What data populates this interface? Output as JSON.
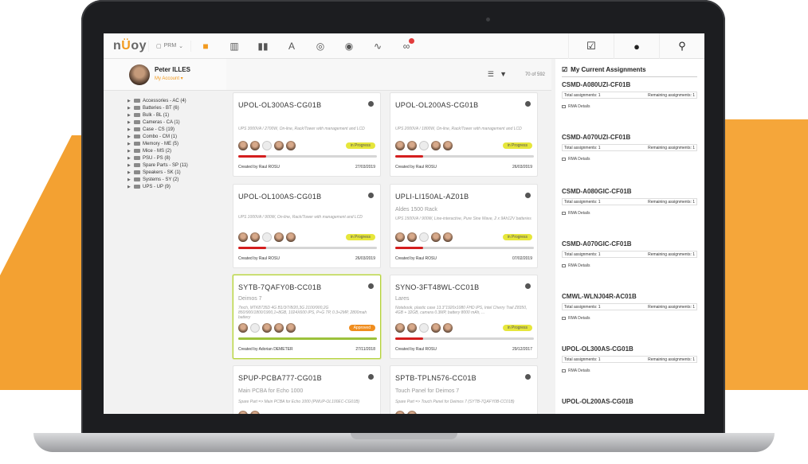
{
  "app": {
    "logo_pre": "n",
    "logo_o": "Ü",
    "logo_post": "oy",
    "prm_label": "PRM"
  },
  "colors": {
    "accent": "#f29a1f",
    "progress_red": "#d41e1e",
    "in_progress": "#e6e63b",
    "approved": "#f08d1e",
    "selected_border": "#b3d23c"
  },
  "nav_icons": [
    "box-icon",
    "cabinet-icon",
    "columns-icon",
    "translate-icon",
    "location-icon",
    "globe-icon",
    "pulse-icon",
    "link-icon"
  ],
  "top_right_icons": [
    "checklist-icon",
    "help-icon",
    "search-icon"
  ],
  "profile": {
    "name": "Peter ILLES",
    "account": "My Account ▾"
  },
  "tree": [
    "Accessories - AC (4)",
    "Batteries - BT (6)",
    "Bulk - BL (1)",
    "Cameras - CA (1)",
    "Case - CS (19)",
    "Combo - CM (1)",
    "Memory - ME (5)",
    "Mice - MS (2)",
    "PSU - PS (8)",
    "Spare Parts - SP (11)",
    "Speakers - SK (1)",
    "Systems - SY (2)",
    "UPS - UP (9)"
  ],
  "list": {
    "count": "70 of 592"
  },
  "cards": [
    {
      "title": "UPOL-OL300AS-CG01B",
      "subtitle": "",
      "desc": "UPS 3000VA / 2700W, On-line, Rack/Tower with management and LCD",
      "status": "in Progress",
      "creator": "Created by Raul ROSU",
      "date": "27/03/2019"
    },
    {
      "title": "UPOL-OL200AS-CG01B",
      "subtitle": "",
      "desc": "UPS 2000VA / 1800W, On-line, Rack/Tower with management and LCD",
      "status": "in Progress",
      "creator": "Created by Raul ROSU",
      "date": "26/03/2019"
    },
    {
      "title": "UPOL-OL100AS-CG01B",
      "subtitle": "",
      "desc": "UPS 1000VA / 900W, On-line, Rack/Tower with management and LCD",
      "status": "in Progress",
      "creator": "Created by Raul ROSU",
      "date": "26/03/2019"
    },
    {
      "title": "UPLI-LI150AL-AZ01B",
      "subtitle": "Aldes 1500 Rack",
      "desc": "UPS 1500VA / 900W, Line-interactive, Pure Sine Wave, 2 x 9Ah12V batteries",
      "status": "in Progress",
      "creator": "Created by Raul ROSU",
      "date": "07/02/2019"
    },
    {
      "title": "SYTB-7QAFY0B-CC01B",
      "subtitle": "Deimos 7",
      "desc": "7inch, MTK8735D 4G B1/3/7/8/20,3G 2100/900,2G 850/900/1800/1900,1+8GB, 1024X600 IPS, P+G TP, 0.3+2MP, 2800mah battery",
      "status": "Approved",
      "creator": "Created by Adorian DEMETER",
      "date": "27/11/2018"
    },
    {
      "title": "SYNO-3FT48WL-CC01B",
      "subtitle": "Lares",
      "desc": "Notebook, plastic case 13.3\"1920x1080 FHD IPS, Intel Cherry Trail Z8350, 4GB + 32GB, camera 0.3MP, battery 8000 mAh, ...",
      "status": "in Progress",
      "creator": "Created by Raul ROSU",
      "date": "29/12/2017"
    },
    {
      "title": "SPUP-PCBA777-CG01B",
      "subtitle": "Main PCBA for Echo 1000",
      "desc": "Spare Part => Main PCBA for Echo 1000 (PWUP-OL100EC-CG01B)",
      "status": "",
      "creator": "",
      "date": ""
    },
    {
      "title": "SPTB-TPLN576-CC01B",
      "subtitle": "Touch Panel for Deimos 7",
      "desc": "Spare Part => Touch Panel for Deimos 7 (SYTB-7QAFY0B-CC01B)",
      "status": "",
      "creator": "",
      "date": ""
    }
  ],
  "progress": [
    0.2,
    0.2,
    0.2,
    0.2,
    1.0,
    0.2
  ],
  "assignments": {
    "heading": "My Current Assignments",
    "items": [
      {
        "title": "CSMD-A080UZI-CF01B",
        "total": "Total assignments: 1",
        "remaining": "Remaining assignments: 1",
        "link": "RMA Details"
      },
      {
        "title": "CSMD-A070UZI-CF01B",
        "total": "Total assignments: 1",
        "remaining": "Remaining assignments: 1",
        "link": "RMA Details"
      },
      {
        "title": "CSMD-A080GIC-CF01B",
        "total": "Total assignments: 1",
        "remaining": "Remaining assignments: 1",
        "link": "RMA Details"
      },
      {
        "title": "CSMD-A070GIC-CF01B",
        "total": "Total assignments: 1",
        "remaining": "Remaining assignments: 1",
        "link": "RMA Details"
      },
      {
        "title": "CMWL-WLNJ04R-AC01B",
        "total": "Total assignments: 1",
        "remaining": "Remaining assignments: 1",
        "link": "RMA Details"
      },
      {
        "title": "UPOL-OL300AS-CG01B",
        "total": "Total assignments: 1",
        "remaining": "Remaining assignments: 1",
        "link": "RMA Details"
      },
      {
        "title": "UPOL-OL200AS-CG01B",
        "total": "",
        "remaining": "",
        "link": ""
      }
    ]
  }
}
